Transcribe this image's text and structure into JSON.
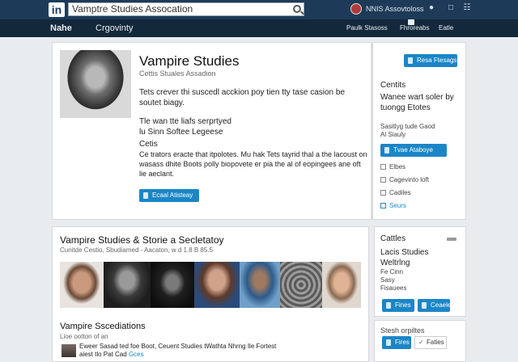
{
  "top": {
    "logo": "in",
    "search_value": "Vamptre Studies Assocation",
    "user_label": "NNIS Assovtoloss"
  },
  "nav": {
    "home": "Nahe",
    "company": "Crgovinty",
    "right1": "Paulk Stasoss",
    "right2": "Fhroreabs",
    "right3": "Eatle"
  },
  "profile": {
    "title": "Vampire Studies",
    "subtitle": "Cettis Stuales Assadion",
    "para1": "Tets crever thi suscedl acckion poy tien tty tase casion be soutet biagy.",
    "para2": "Tle wan tte liafs serprtyed\nlu Sinn Softee Legeese",
    "para3": "Cetis",
    "para4": "Ce trators eracte that itpolotes. Mu hak Tets tayrid thal a the lacoust on wasass dhite Boots polly biopovete er pia the al of eopingees ane oft lie aeclant.",
    "button": "Ecaal Atisteay"
  },
  "side1": {
    "button": "Resa Ftesags",
    "title": "Centits",
    "text": "Wanee wart soler by tuongg Etotes",
    "small1": "Sasitlyg tude Gaod",
    "small2": "Al Siauly",
    "button2": "Tvae Ataboye",
    "items": [
      "Elbes",
      "Cagevinto loft",
      "Cadiles",
      "Seurs"
    ]
  },
  "second": {
    "title": "Vampire Studies & Storie a Secletatoy",
    "meta": "Cunitde Cestio, Sbudiamed - Aacaton, w d 1.8 B 85.5",
    "section_title": "Vampire Sscediations",
    "section_sub": "Lioe ootton of an",
    "item_text": "Eweer Sasad ted foe Boot, Ceuent Studies tWathta Nhrng Ile Fortest aiest tlo Pat Cad",
    "item_link": "Gces"
  },
  "side2": {
    "title": "Cattles",
    "text": "Lacis Studies Weltrlng",
    "small1": "Fe Cinn",
    "small2": "Sasy",
    "small3": "Fisauees",
    "btn1": "Fines",
    "btn2": "Ceaele",
    "title2": "Stesh orpiltes",
    "btn3": "Fires",
    "btn4": "Faties"
  },
  "colors": {
    "topbar": "#1d3b58",
    "navbar": "#14283b",
    "accent": "#1b86c6",
    "background": "#e9ecef"
  },
  "icons": [
    "search-icon",
    "bell-icon",
    "message-icon",
    "grid-icon",
    "briefcase-icon",
    "gear-icon"
  ]
}
